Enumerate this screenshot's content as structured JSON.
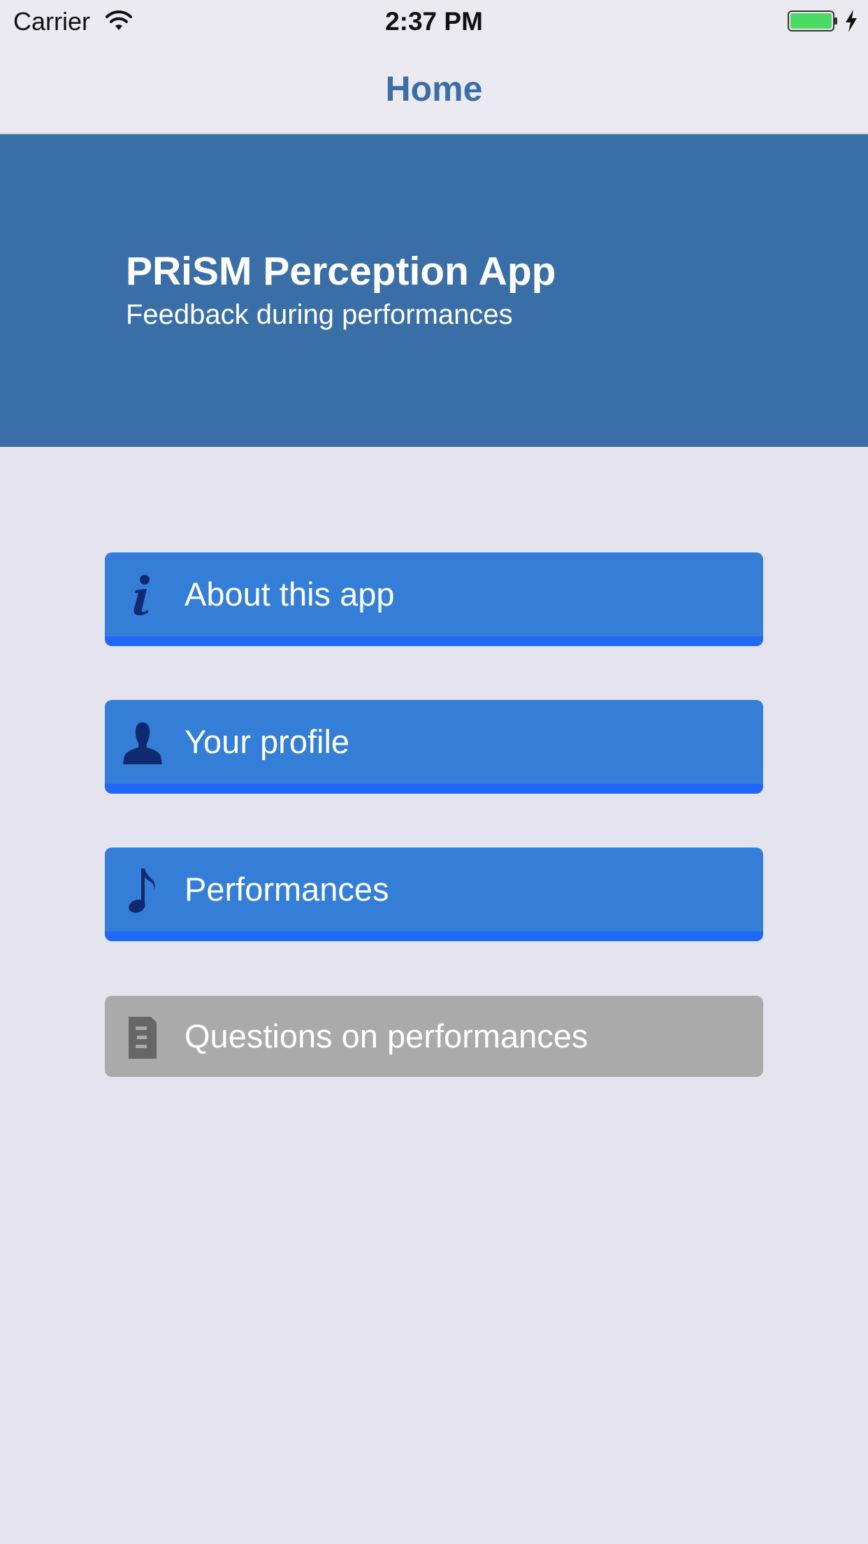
{
  "status_bar": {
    "carrier": "Carrier",
    "time": "2:37 PM"
  },
  "nav": {
    "title": "Home"
  },
  "banner": {
    "title": "PRiSM Perception App",
    "subtitle": "Feedback during performances"
  },
  "menu": {
    "items": [
      {
        "label": "About this app",
        "icon": "info-icon",
        "enabled": true
      },
      {
        "label": "Your profile",
        "icon": "person-icon",
        "enabled": true
      },
      {
        "label": "Performances",
        "icon": "music-note-icon",
        "enabled": true
      },
      {
        "label": "Questions on performances",
        "icon": "document-icon",
        "enabled": false
      }
    ]
  },
  "colors": {
    "accent": "#3a6ea6",
    "banner": "#396ea6",
    "button": "#347ed8",
    "button_edge": "#1f68f8",
    "button_disabled": "#aaaaaa",
    "icon": "#0f2a70",
    "icon_disabled": "#666666",
    "background": "#e4e3ee",
    "battery": "#4cd964"
  }
}
